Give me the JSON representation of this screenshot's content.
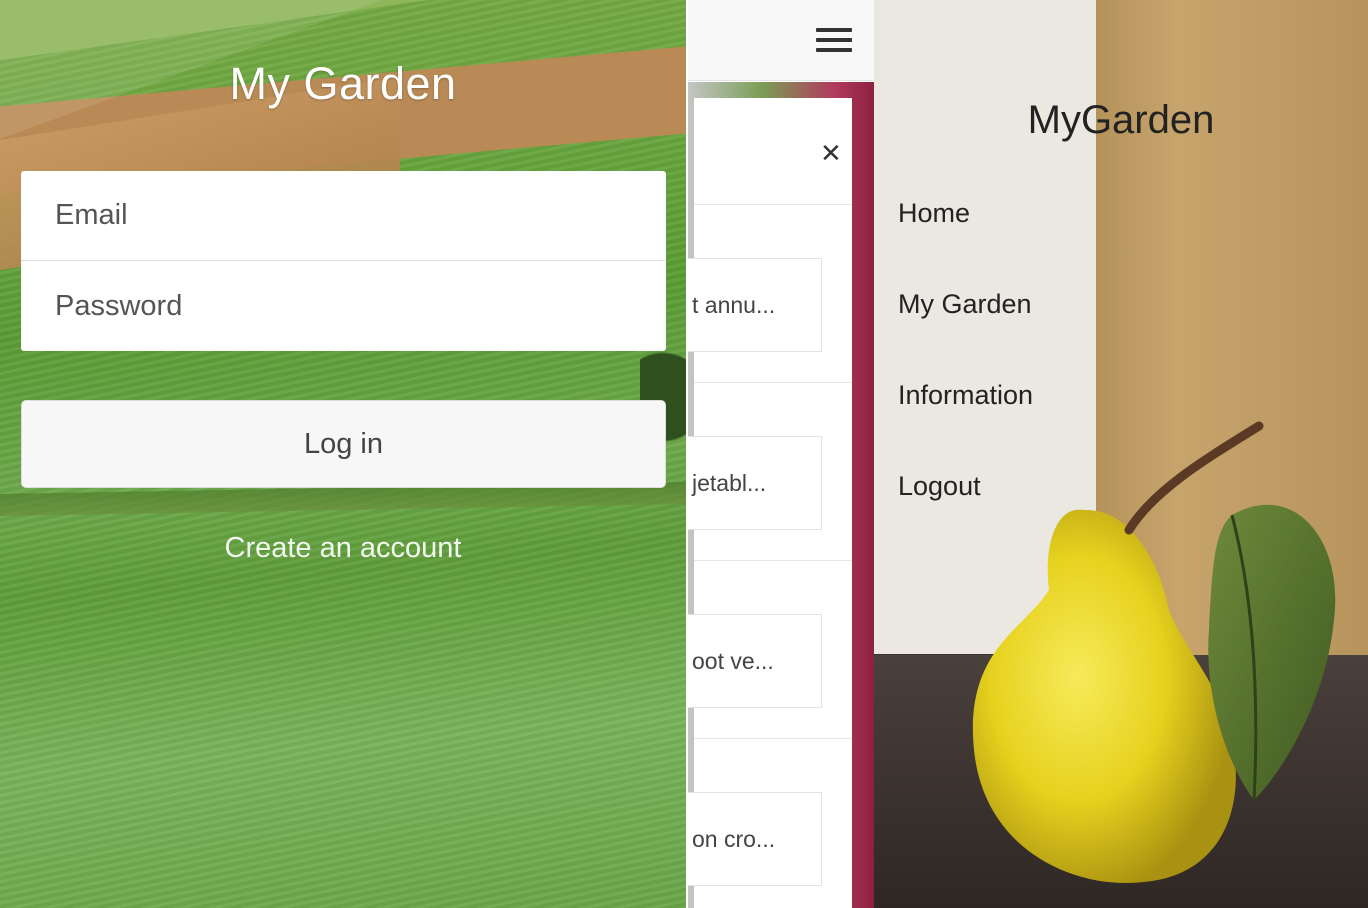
{
  "login": {
    "title": "My Garden",
    "email_placeholder": "Email",
    "password_placeholder": "Password",
    "login_button": "Log in",
    "create_account_link": "Create an account"
  },
  "list_screen": {
    "menu_icon": "hamburger-icon",
    "close_icon": "close-icon",
    "close_glyph": "✕",
    "items": [
      {
        "label": "t annu..."
      },
      {
        "label": "jetabl..."
      },
      {
        "label": "oot ve..."
      },
      {
        "label": "on cro..."
      }
    ]
  },
  "side_menu": {
    "title": "MyGarden",
    "items": [
      {
        "label": "Home"
      },
      {
        "label": "My Garden"
      },
      {
        "label": "Information"
      },
      {
        "label": "Logout"
      }
    ]
  },
  "colors": {
    "login_field_bg": "#ffffff",
    "login_button_bg": "#f7f7f7",
    "menu_text": "#222222",
    "login_title_text": "#ffffff"
  }
}
